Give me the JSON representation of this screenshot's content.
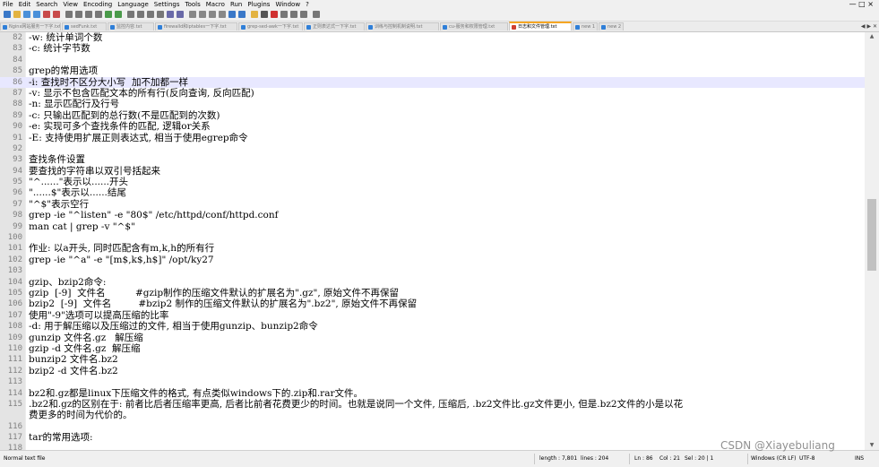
{
  "app": {
    "window_controls": "— □ ×",
    "menu": [
      "File",
      "Edit",
      "Search",
      "View",
      "Encoding",
      "Language",
      "Settings",
      "Tools",
      "Macro",
      "Run",
      "Plugins",
      "Window",
      "?"
    ]
  },
  "toolbar": {
    "icons": [
      "new-file-icon",
      "open-file-icon",
      "save-icon",
      "save-all-icon",
      "close-icon",
      "close-all-icon",
      "print-icon",
      "cut-icon",
      "copy-icon",
      "paste-icon",
      "undo-icon",
      "redo-icon",
      "find-icon",
      "replace-icon",
      "zoom-in-icon",
      "zoom-out-icon",
      "sync-scroll-v-icon",
      "sync-scroll-h-icon",
      "word-wrap-icon",
      "show-all-chars-icon",
      "indent-guide-icon",
      "language-icon",
      "doc-map-icon",
      "function-list-icon",
      "folder-workspace-icon",
      "monitor-icon",
      "record-macro-icon",
      "stop-macro-icon",
      "play-macro-icon",
      "run-macro-multiple-icon",
      "save-macro-icon"
    ]
  },
  "tabs": [
    {
      "label": "Nginx网站服务一下字.txt",
      "active": false
    },
    {
      "label": "sedFunk.txt",
      "active": false
    },
    {
      "label": "监控内容.txt",
      "active": false
    },
    {
      "label": "firewalld和iptables一下字.txt",
      "active": false
    },
    {
      "label": "grep-sed-awk一下字.txt",
      "active": false
    },
    {
      "label": "正则表达式一下字.txt",
      "active": false
    },
    {
      "label": "训练与控制机制说明.txt",
      "active": false
    },
    {
      "label": "cu-服务和权限管理.txt",
      "active": false
    },
    {
      "label": "日志和文件管理.txt",
      "active": true
    },
    {
      "label": "new 1",
      "active": false
    },
    {
      "label": "new 2",
      "active": false
    }
  ],
  "tab_nav": "◀ ▶ ✕",
  "editor": {
    "lines": [
      {
        "n": "82",
        "text": "-w: 统计单词个数"
      },
      {
        "n": "83",
        "text": "-c: 统计字节数"
      },
      {
        "n": "84",
        "text": ""
      },
      {
        "n": "85",
        "text": "grep的常用选项"
      },
      {
        "n": "86",
        "text": "-i: 查找时不区分大小写  加不加都一样",
        "current": true
      },
      {
        "n": "87",
        "text": "-v: 显示不包含匹配文本的所有行(反向查询, 反向匹配)"
      },
      {
        "n": "88",
        "text": "-n: 显示匹配行及行号"
      },
      {
        "n": "89",
        "text": "-c: 只输出匹配到的总行数(不是匹配到的次数)"
      },
      {
        "n": "90",
        "text": "-e: 实现可多个查找条件的匹配, 逻辑or关系"
      },
      {
        "n": "91",
        "text": "-E: 支持使用扩展正则表达式, 相当于使用egrep命令"
      },
      {
        "n": "92",
        "text": ""
      },
      {
        "n": "93",
        "text": "查找条件设置"
      },
      {
        "n": "94",
        "text": "要查找的字符串以双引号括起来"
      },
      {
        "n": "95",
        "text": "\"^......\"表示以......开头"
      },
      {
        "n": "96",
        "text": "\"......$\"表示以......结尾"
      },
      {
        "n": "97",
        "text": "\"^$\"表示空行"
      },
      {
        "n": "98",
        "text": "grep -ie \"^listen\" -e \"80$\" /etc/httpd/conf/httpd.conf"
      },
      {
        "n": "99",
        "text": "man cat | grep -v \"^$\""
      },
      {
        "n": "100",
        "text": ""
      },
      {
        "n": "101",
        "text": "作业: 以a开头, 同时匹配含有m,k,h的所有行"
      },
      {
        "n": "102",
        "text": "grep -ie \"^a\" -e \"[m$,k$,h$]\" /opt/ky27"
      },
      {
        "n": "103",
        "text": ""
      },
      {
        "n": "104",
        "text": "gzip、bzip2命令:"
      },
      {
        "n": "105",
        "text": "gzip  [-9]  文件名          #gzip制作的压缩文件默认的扩展名为\".gz\", 原始文件不再保留"
      },
      {
        "n": "106",
        "text": "bzip2  [-9]  文件名         #bzip2 制作的压缩文件默认的扩展名为\".bz2\", 原始文件不再保留"
      },
      {
        "n": "107",
        "text": "使用\"-9\"选项可以提高压缩的比率"
      },
      {
        "n": "108",
        "text": "-d: 用于解压缩以及压缩过的文件, 相当于使用gunzip、bunzip2命令"
      },
      {
        "n": "109",
        "text": "gunzip 文件名.gz   解压缩"
      },
      {
        "n": "110",
        "text": "gzip -d 文件名.gz  解压缩"
      },
      {
        "n": "111",
        "text": "bunzip2 文件名.bz2"
      },
      {
        "n": "112",
        "text": "bzip2 -d 文件名.bz2"
      },
      {
        "n": "113",
        "text": ""
      },
      {
        "n": "114",
        "text": "bz2和.gz都是linux下压缩文件的格式, 有点类似windows下的.zip和.rar文件。"
      },
      {
        "n": "115",
        "text": ".bz2和.gz的区别在于: 前者比后者压缩率更高, 后者比前者花费更少的时间。也就是说同一个文件, 压缩后, .bz2文件比.gz文件更小, 但是.bz2文件的小是以花"
      },
      {
        "n": "",
        "text": "费更多的时间为代价的。"
      },
      {
        "n": "116",
        "text": ""
      },
      {
        "n": "117",
        "text": "tar的常用选项:"
      },
      {
        "n": "118",
        "text": ""
      }
    ]
  },
  "status": {
    "file_type": "Normal text file",
    "length": "length : 7,801",
    "lines": "lines : 204",
    "ln": "Ln : 86",
    "col": "Col : 21",
    "sel": "Sel : 20 | 1",
    "eol": "Windows (CR LF)",
    "encoding": "UTF-8",
    "mode": "INS"
  },
  "watermark": "CSDN @Xiayebuliang"
}
